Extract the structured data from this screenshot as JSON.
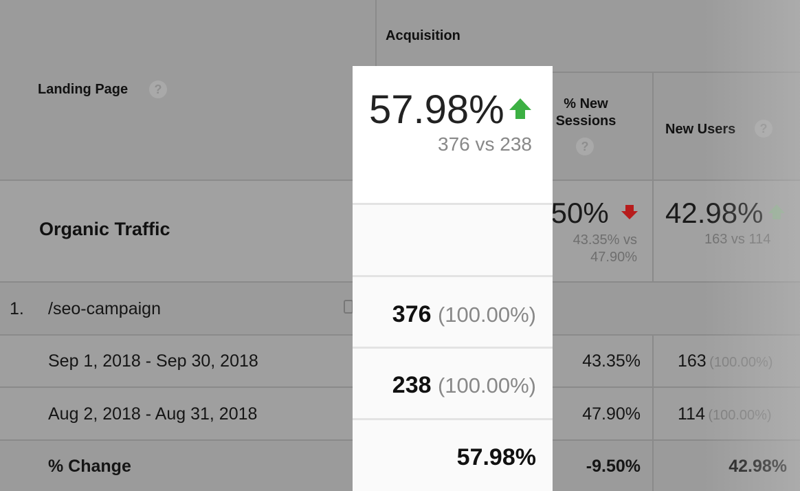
{
  "header": {
    "landing_page": "Landing Page",
    "group": "Acquisition",
    "col_new_sessions": "% New Sessions",
    "col_new_users": "New Users"
  },
  "highlight": {
    "change": "57.98%",
    "compare": "376 vs 238",
    "trend": "up",
    "row1_value": "376",
    "row1_pct": "(100.00%)",
    "row2_value": "238",
    "row2_pct": "(100.00%)",
    "change_row": "57.98%"
  },
  "segment": {
    "label": "Organic Traffic",
    "new_sessions_change": ".50%",
    "new_sessions_trend": "down",
    "new_sessions_compare": "43.35% vs 47.90%",
    "new_users_change": "42.98%",
    "new_users_trend": "up",
    "new_users_compare": "163 vs 114"
  },
  "rows": [
    {
      "index": "1.",
      "page": "/seo-campaign"
    },
    {
      "label": "Sep 1, 2018 - Sep 30, 2018",
      "new_sessions": "43.35%",
      "new_users": "163",
      "new_users_pct": "(100.00%)"
    },
    {
      "label": "Aug 2, 2018 - Aug 31, 2018",
      "new_sessions": "47.90%",
      "new_users": "114",
      "new_users_pct": "(100.00%)"
    },
    {
      "label": "% Change",
      "new_sessions": "-9.50%",
      "new_users": "42.98%"
    }
  ],
  "colors": {
    "up": "#3cb043",
    "down": "#c62828"
  }
}
